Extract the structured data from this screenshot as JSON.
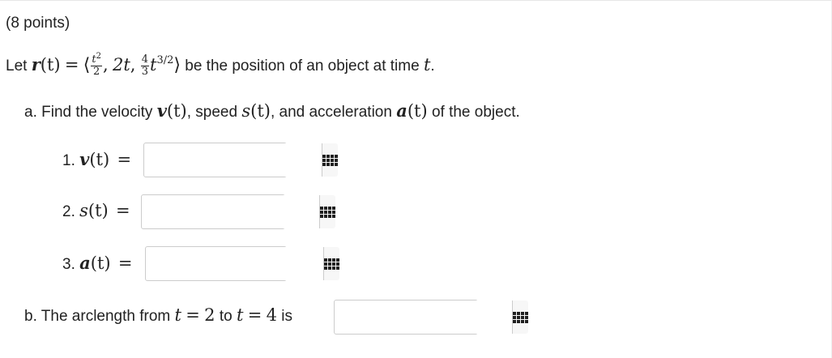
{
  "header": {
    "points": "(8 points)"
  },
  "problem": {
    "let_word": "Let",
    "r": "r",
    "t_paren": "(t)",
    "equals": "=",
    "angle_open": "⟨",
    "t": "t",
    "exp_2": "2",
    "den_2": "2",
    "comma": ",",
    "two_t": "2t",
    "num_4": "4",
    "den_3": "3",
    "exp_3_2": "3/2",
    "angle_close": "⟩",
    "statement": "be the position of an object at time"
  },
  "part_a": {
    "prefix": "a. Find the velocity",
    "v": "v",
    "speed_word": ", speed",
    "s": "s",
    "accel_word": ", and acceleration",
    "a": "a",
    "suffix": "of the object."
  },
  "items": [
    {
      "label": "1.",
      "var": "v"
    },
    {
      "label": "2.",
      "var": "s"
    },
    {
      "label": "3.",
      "var": "a"
    }
  ],
  "part_b": {
    "prefix": "b. The arclength from",
    "t": "t",
    "eq": "=",
    "from_val": "2",
    "to_word": "to",
    "to_val": "4",
    "is_word": "is"
  },
  "answers": {
    "velocity": "",
    "speed": "",
    "acceleration": "",
    "arclength": ""
  },
  "icons": {
    "equation_editor": "matrix-grid-icon"
  }
}
